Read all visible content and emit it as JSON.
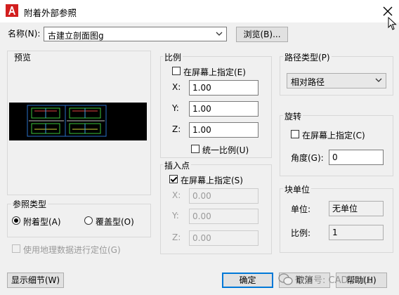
{
  "window": {
    "title": "附着外部参照"
  },
  "name_row": {
    "label": "名称(N):",
    "value": "古建立剖面图g",
    "browse_label": "浏览(B)..."
  },
  "preview": {
    "label": "预览"
  },
  "scale": {
    "title": "比例",
    "specify_label": "在屏幕上指定(E)",
    "x_label": "X:",
    "x_value": "1.00",
    "y_label": "Y:",
    "y_value": "1.00",
    "z_label": "Z:",
    "z_value": "1.00",
    "uniform_label": "统一比例(U)"
  },
  "insertion": {
    "title": "插入点",
    "specify_label": "在屏幕上指定(S)",
    "x_label": "X:",
    "x_value": "0.00",
    "y_label": "Y:",
    "y_value": "0.00",
    "z_label": "Z:",
    "z_value": "0.00"
  },
  "path_type": {
    "title": "路径类型(P)",
    "value": "相对路径"
  },
  "rotation": {
    "title": "旋转",
    "specify_label": "在屏幕上指定(C)",
    "angle_label": "角度(G):",
    "angle_value": "0"
  },
  "block_unit": {
    "title": "块单位",
    "unit_label": "单位:",
    "unit_value": "无单位",
    "factor_label": "比例:",
    "factor_value": "1"
  },
  "reference_type": {
    "title": "参照类型",
    "attach_label": "附着型(A)",
    "overlay_label": "覆盖型(O)"
  },
  "geo_label": "使用地理数据进行定位(G)",
  "footer": {
    "details_label": "显示细节(W)",
    "ok_label": "确定",
    "cancel_label": "取消",
    "help_label": "帮助(H)"
  },
  "watermark": {
    "text": "微信号: CADSKILL"
  },
  "colors": {
    "app_icon_red": "#d21f1f",
    "accent": "#0078d7"
  }
}
